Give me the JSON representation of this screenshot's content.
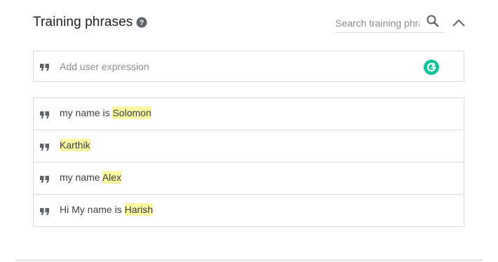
{
  "header": {
    "title": "Training phrases",
    "help_icon": "help-circle-icon",
    "search_placeholder": "Search training phrases",
    "search_icon": "search-icon",
    "collapse_icon": "chevron-up-icon"
  },
  "add_expression": {
    "placeholder": "Add user expression",
    "quote_icon": "quote-icon",
    "grammarly_icon": "grammarly-icon",
    "grammarly_color": "#15c39a"
  },
  "phrases": [
    {
      "prefix": "my name is ",
      "highlight": "Solomon"
    },
    {
      "prefix": "",
      "highlight": "Karthik"
    },
    {
      "prefix": "my name ",
      "highlight": "Alex"
    },
    {
      "prefix": "Hi My name is ",
      "highlight": "Harish"
    }
  ],
  "colors": {
    "highlight": "#fbf8a4",
    "border": "#dcdcdc",
    "icon": "#5f6368"
  }
}
